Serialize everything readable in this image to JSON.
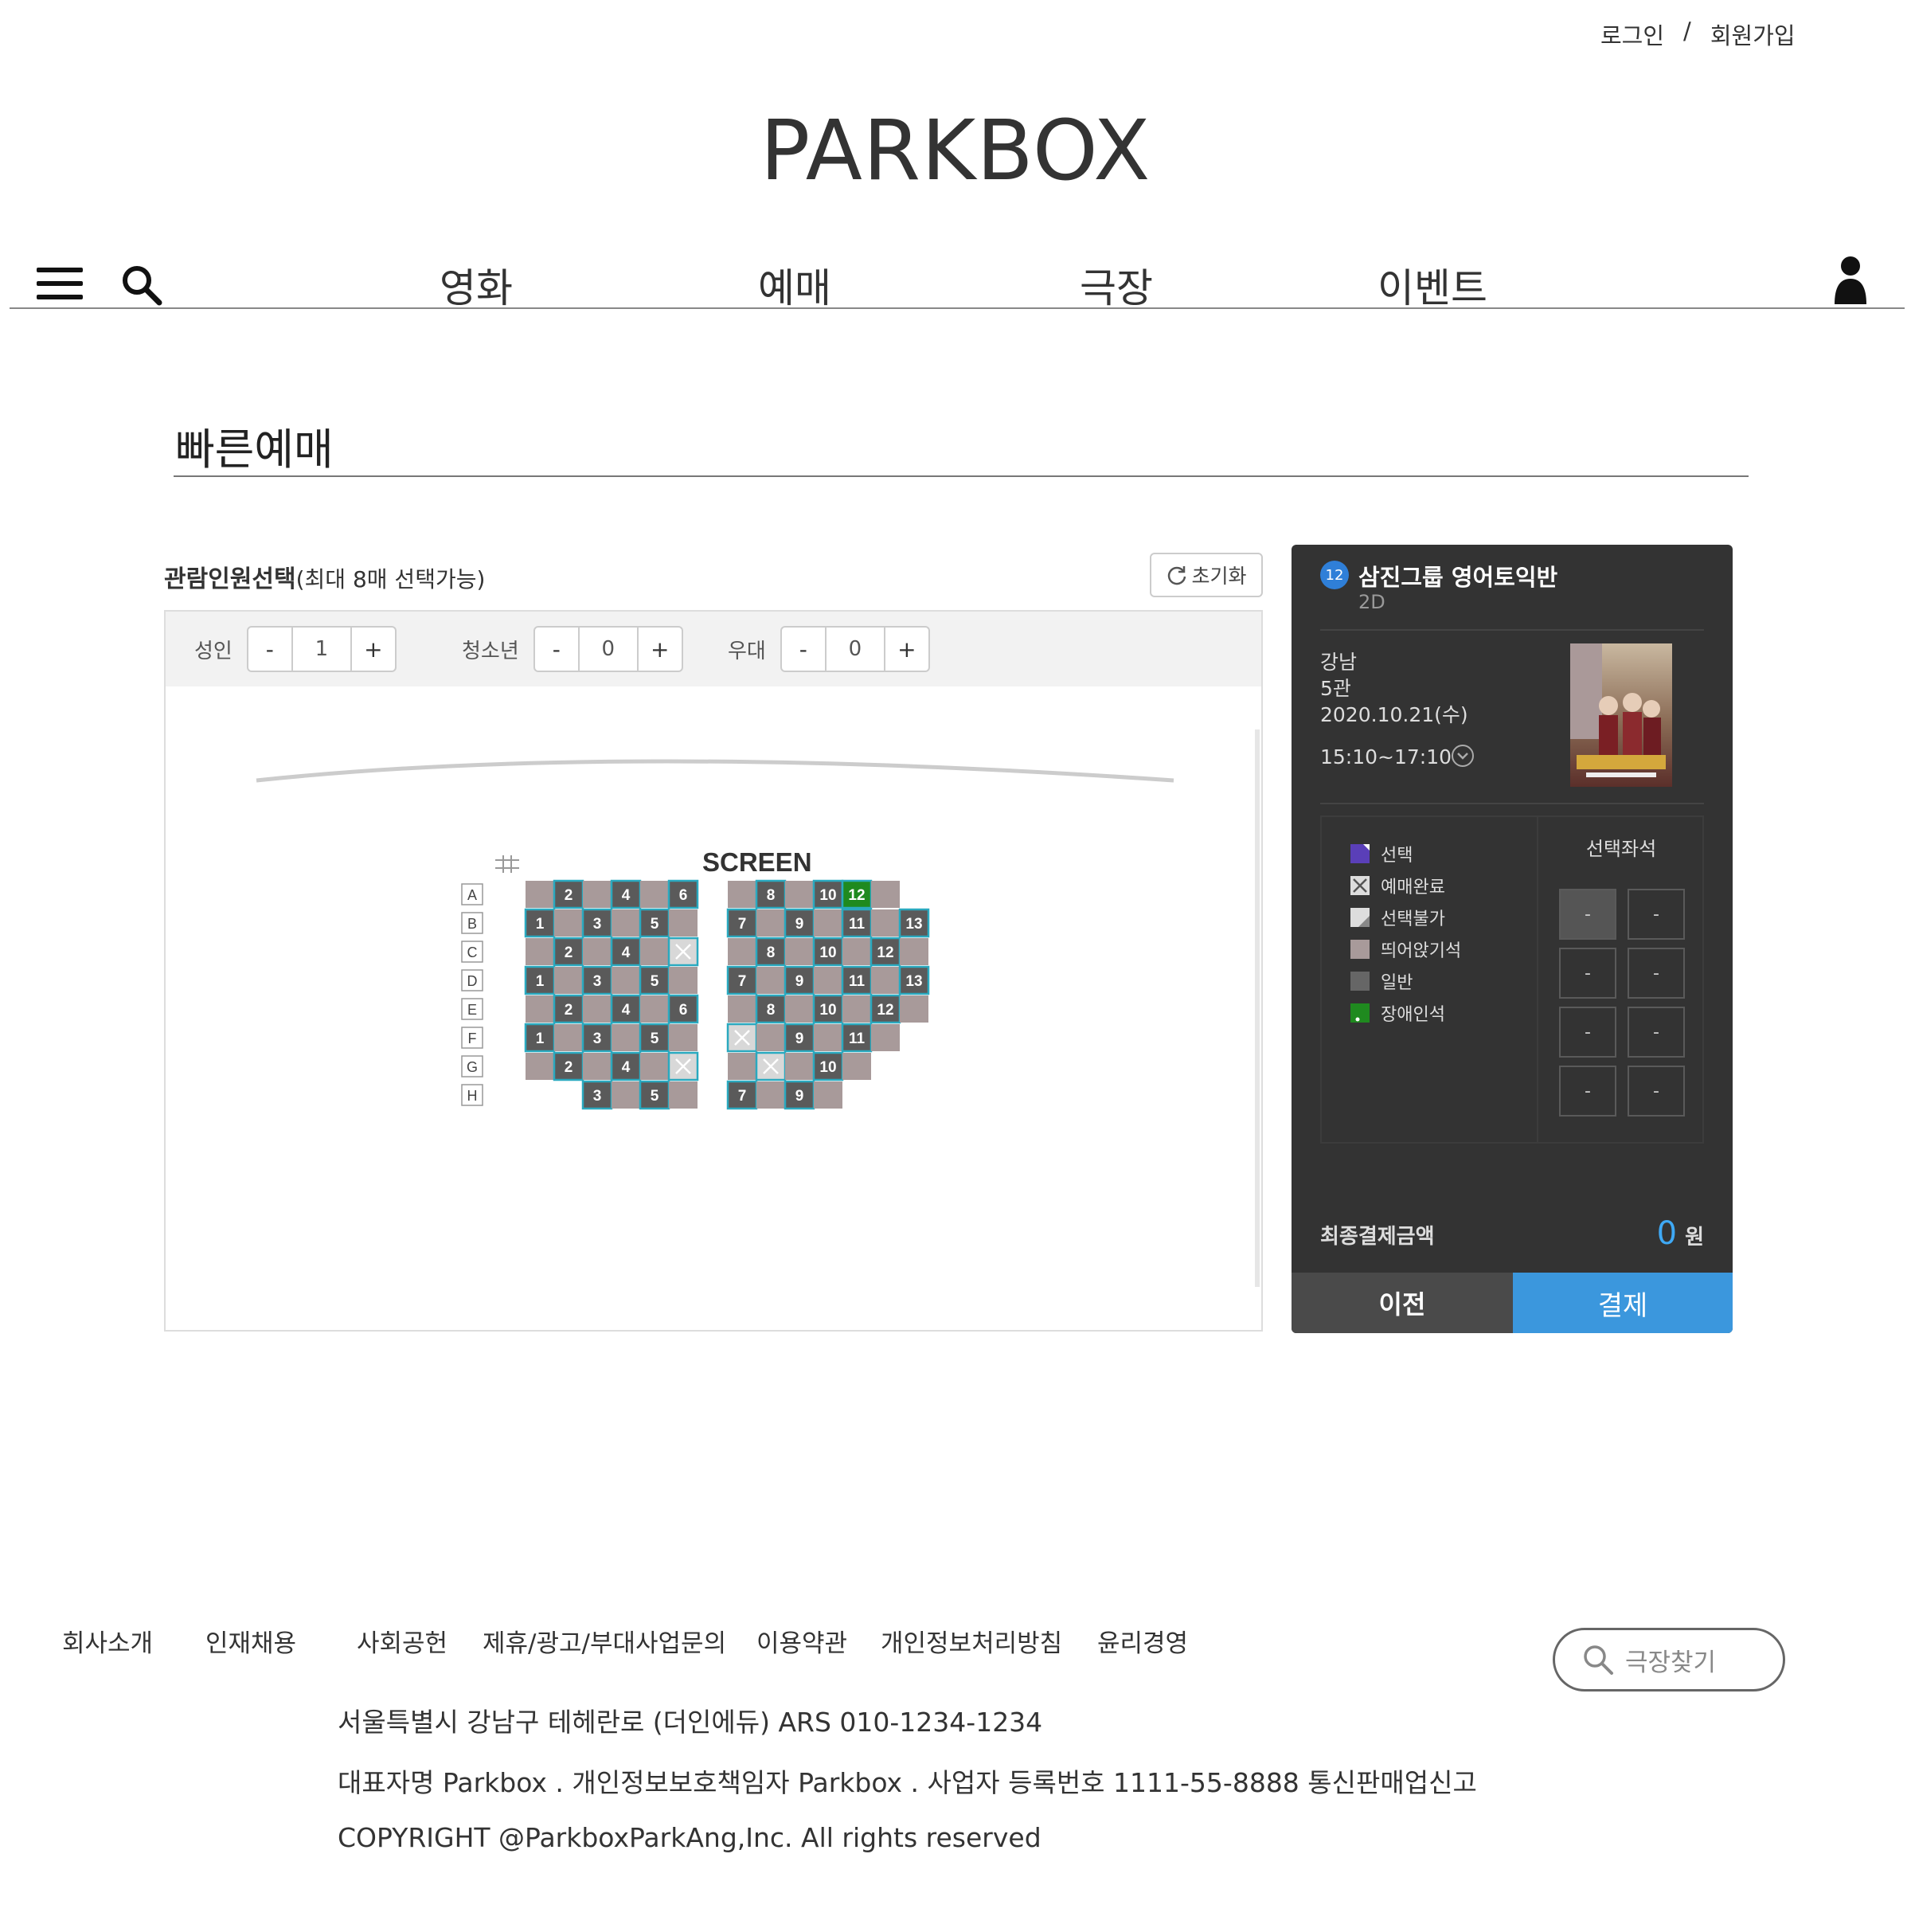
{
  "header": {
    "login": "로그인",
    "sep": "/",
    "signup": "회원가입",
    "logo": "PARKBOX"
  },
  "nav": {
    "items": [
      "영화",
      "예매",
      "극장",
      "이벤트"
    ]
  },
  "page": {
    "title": "빠른예매"
  },
  "people": {
    "title": "관람인원선택",
    "note": "(최대 8매 선택가능)",
    "reset": "초기화",
    "counters": [
      {
        "label": "성인",
        "minus": "-",
        "value": "1",
        "plus": "+"
      },
      {
        "label": "청소년",
        "minus": "-",
        "value": "0",
        "plus": "+"
      },
      {
        "label": "우대",
        "minus": "-",
        "value": "0",
        "plus": "+"
      }
    ]
  },
  "seatmap": {
    "screen": "SCREEN",
    "rows": [
      {
        "label": "A",
        "left": [
          {
            "t": "g"
          },
          {
            "n": "2",
            "t": "n"
          },
          {
            "t": "g"
          },
          {
            "n": "4",
            "t": "n"
          },
          {
            "t": "g"
          },
          {
            "n": "6",
            "t": "n"
          }
        ],
        "right": [
          {
            "t": "g"
          },
          {
            "n": "8",
            "t": "n"
          },
          {
            "t": "g"
          },
          {
            "n": "10",
            "t": "n"
          },
          {
            "n": "12",
            "t": "h"
          },
          {
            "t": "g"
          }
        ]
      },
      {
        "label": "B",
        "left": [
          {
            "n": "1",
            "t": "n"
          },
          {
            "t": "g"
          },
          {
            "n": "3",
            "t": "n"
          },
          {
            "t": "g"
          },
          {
            "n": "5",
            "t": "n"
          },
          {
            "t": "g"
          }
        ],
        "right": [
          {
            "n": "7",
            "t": "n"
          },
          {
            "t": "g"
          },
          {
            "n": "9",
            "t": "n"
          },
          {
            "t": "g"
          },
          {
            "n": "11",
            "t": "n"
          },
          {
            "t": "g"
          },
          {
            "n": "13",
            "t": "n"
          }
        ]
      },
      {
        "label": "C",
        "left": [
          {
            "t": "g"
          },
          {
            "n": "2",
            "t": "n"
          },
          {
            "t": "g"
          },
          {
            "n": "4",
            "t": "n"
          },
          {
            "t": "g"
          },
          {
            "t": "x"
          }
        ],
        "right": [
          {
            "t": "g"
          },
          {
            "n": "8",
            "t": "n"
          },
          {
            "t": "g"
          },
          {
            "n": "10",
            "t": "n"
          },
          {
            "t": "g"
          },
          {
            "n": "12",
            "t": "n"
          },
          {
            "t": "g"
          }
        ]
      },
      {
        "label": "D",
        "left": [
          {
            "n": "1",
            "t": "n"
          },
          {
            "t": "g"
          },
          {
            "n": "3",
            "t": "n"
          },
          {
            "t": "g"
          },
          {
            "n": "5",
            "t": "n"
          },
          {
            "t": "g"
          }
        ],
        "right": [
          {
            "n": "7",
            "t": "n"
          },
          {
            "t": "g"
          },
          {
            "n": "9",
            "t": "n"
          },
          {
            "t": "g"
          },
          {
            "n": "11",
            "t": "n"
          },
          {
            "t": "g"
          },
          {
            "n": "13",
            "t": "n"
          }
        ]
      },
      {
        "label": "E",
        "left": [
          {
            "t": "g"
          },
          {
            "n": "2",
            "t": "n"
          },
          {
            "t": "g"
          },
          {
            "n": "4",
            "t": "n"
          },
          {
            "t": "g"
          },
          {
            "n": "6",
            "t": "n"
          }
        ],
        "right": [
          {
            "t": "g"
          },
          {
            "n": "8",
            "t": "n"
          },
          {
            "t": "g"
          },
          {
            "n": "10",
            "t": "n"
          },
          {
            "t": "g"
          },
          {
            "n": "12",
            "t": "n"
          },
          {
            "t": "g"
          }
        ]
      },
      {
        "label": "F",
        "left": [
          {
            "n": "1",
            "t": "n"
          },
          {
            "t": "g"
          },
          {
            "n": "3",
            "t": "n"
          },
          {
            "t": "g"
          },
          {
            "n": "5",
            "t": "n"
          },
          {
            "t": "g"
          }
        ],
        "right": [
          {
            "t": "x"
          },
          {
            "t": "g"
          },
          {
            "n": "9",
            "t": "n"
          },
          {
            "t": "g"
          },
          {
            "n": "11",
            "t": "n"
          },
          {
            "t": "g"
          }
        ]
      },
      {
        "label": "G",
        "left": [
          {
            "t": "g"
          },
          {
            "n": "2",
            "t": "n"
          },
          {
            "t": "g"
          },
          {
            "n": "4",
            "t": "n"
          },
          {
            "t": "g"
          },
          {
            "t": "x"
          }
        ],
        "right": [
          {
            "t": "g"
          },
          {
            "t": "x"
          },
          {
            "t": "g"
          },
          {
            "n": "10",
            "t": "n"
          },
          {
            "t": "g"
          }
        ]
      },
      {
        "label": "H",
        "left": [
          {
            "t": "e"
          },
          {
            "t": "e"
          },
          {
            "n": "3",
            "t": "n"
          },
          {
            "t": "g"
          },
          {
            "n": "5",
            "t": "n"
          },
          {
            "t": "g"
          }
        ],
        "right": [
          {
            "n": "7",
            "t": "n"
          },
          {
            "t": "g"
          },
          {
            "n": "9",
            "t": "n"
          },
          {
            "t": "g"
          }
        ]
      }
    ]
  },
  "summary": {
    "rating": "12",
    "movie_title": "삼진그룹 영어토익반",
    "format": "2D",
    "theater": "강남",
    "hall": "5관",
    "date": "2020.10.21(수)",
    "time": "15:10~17:10",
    "legend": [
      "선택",
      "예매완료",
      "선택불가",
      "띄어앉기석",
      "일반",
      "장애인석"
    ],
    "selected_title": "선택좌석",
    "slots": [
      "-",
      "-",
      "-",
      "-",
      "-",
      "-",
      "-",
      "-"
    ],
    "pay_label": "최종결제금액",
    "pay_amount": "0",
    "pay_unit": "원",
    "prev": "이전",
    "pay": "결제"
  },
  "footer": {
    "links": [
      "회사소개",
      "인재채용",
      "사회공헌",
      "제휴/광고/부대사업문의",
      "이용약관",
      "개인정보처리방침",
      "윤리경영"
    ],
    "search_label": "극장찾기",
    "address": "서울특별시 강남구 테헤란로 (더인에듀) ARS 010-1234-1234",
    "company": "대표자명 Parkbox . 개인정보보호책임자 Parkbox . 사업자 등록번호 1111-55-8888 통신판매업신고",
    "copyright": "COPYRIGHT @ParkboxParkAng,Inc. All rights reserved"
  },
  "colors": {
    "seat_normal": "#5a5a5a",
    "seat_gap": "#a89a9a",
    "seat_border": "#2aa9bf",
    "seat_handicap": "#1f8a1f",
    "seat_taken": "#d8d8d8",
    "seat_selected": "#5a3fb8",
    "panel_bg": "#333333",
    "accent": "#3b97dd"
  }
}
